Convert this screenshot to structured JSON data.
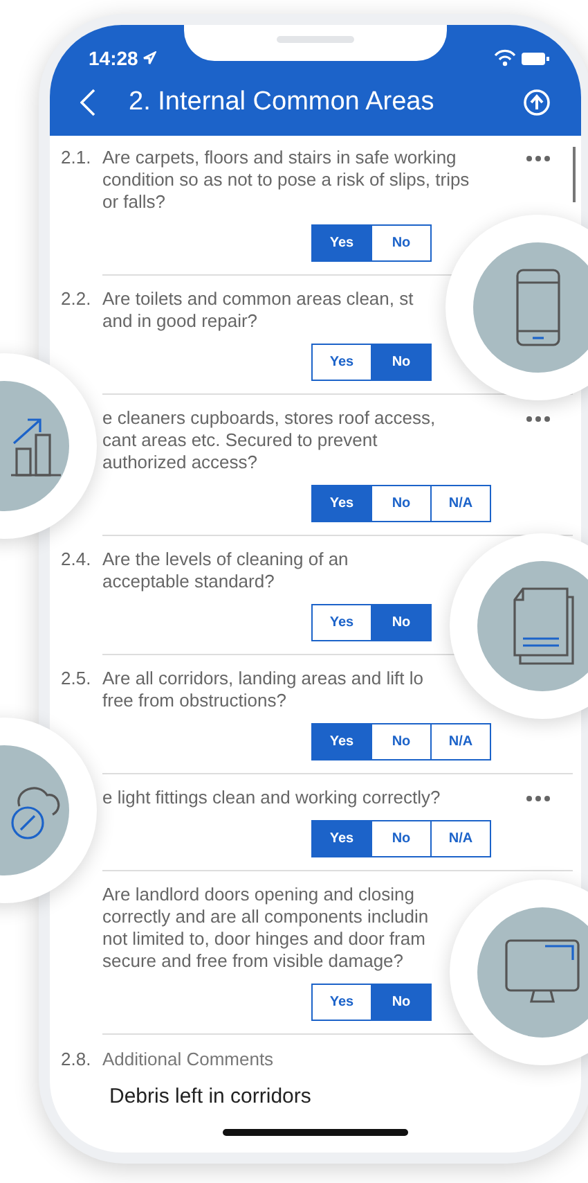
{
  "status_bar": {
    "time": "14:28"
  },
  "header": {
    "title": "2. Internal Common Areas"
  },
  "questions": [
    {
      "number": "2.1.",
      "text": "Are carpets, floors and stairs in safe working\ncondition so as not to pose a risk of slips, trips\nor falls?",
      "has_menu": true,
      "options": [
        {
          "label": "Yes",
          "selected": true
        },
        {
          "label": "No",
          "selected": false
        }
      ]
    },
    {
      "number": "2.2.",
      "text": "Are toilets and common areas clean, st\nand in good repair?",
      "has_menu": false,
      "options": [
        {
          "label": "Yes",
          "selected": false
        },
        {
          "label": "No",
          "selected": true
        }
      ]
    },
    {
      "text": "e cleaners cupboards, stores roof access,\ncant areas etc. Secured to prevent\nauthorized access?",
      "has_menu": true,
      "options": [
        {
          "label": "Yes",
          "selected": true
        },
        {
          "label": "No",
          "selected": false
        },
        {
          "label": "N/A",
          "selected": false
        }
      ]
    },
    {
      "number": "2.4.",
      "text": "Are the levels of cleaning of an\nacceptable standard?",
      "has_menu": false,
      "options": [
        {
          "label": "Yes",
          "selected": false
        },
        {
          "label": "No",
          "selected": true
        }
      ]
    },
    {
      "number": "2.5.",
      "text": "Are all corridors, landing areas and lift lo\nfree from obstructions?",
      "has_menu": false,
      "options": [
        {
          "label": "Yes",
          "selected": true
        },
        {
          "label": "No",
          "selected": false
        },
        {
          "label": "N/A",
          "selected": false
        }
      ]
    },
    {
      "text": "e light fittings clean and working correctly?",
      "has_menu": true,
      "options": [
        {
          "label": "Yes",
          "selected": true
        },
        {
          "label": "No",
          "selected": false
        },
        {
          "label": "N/A",
          "selected": false
        }
      ]
    },
    {
      "text": "Are landlord doors opening and closing\ncorrectly and are all components includin\nnot limited to, door hinges and door fram\nsecure and free from visible damage?",
      "has_menu": false,
      "options": [
        {
          "label": "Yes",
          "selected": false
        },
        {
          "label": "No",
          "selected": true
        }
      ]
    }
  ],
  "comments": {
    "number": "2.8.",
    "label": "Additional Comments",
    "value": "Debris left in corridors"
  }
}
